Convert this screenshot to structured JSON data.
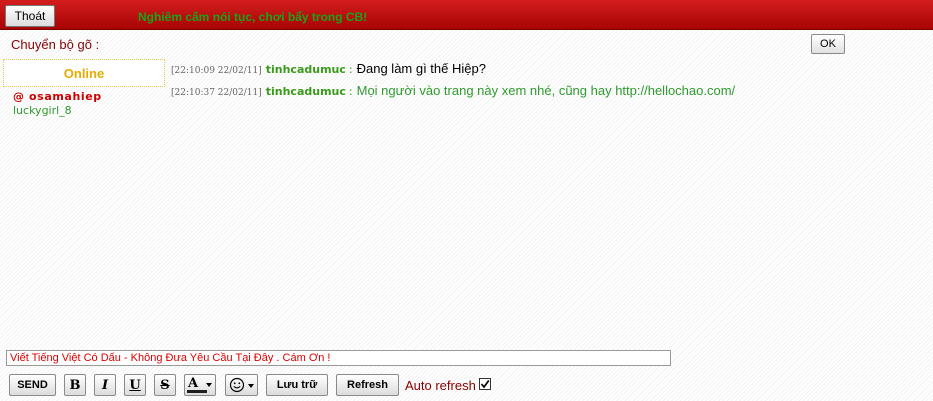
{
  "header": {
    "exit_label": "Thoát",
    "notice": "Nghiêm cấm nói tục, chơi bẩy trong CB!"
  },
  "keyboard": {
    "label": "Chuyển bộ gõ :",
    "ok_label": "OK"
  },
  "sidebar": {
    "online_title": "Online",
    "users": [
      {
        "name": "@ osamahiep",
        "role": "admin"
      },
      {
        "name": "luckygirl_8",
        "role": "member"
      }
    ]
  },
  "messages": [
    {
      "time": "[22:10:09 22/02/11]",
      "nick": "tinhcadumuc",
      "sep": ":",
      "text": "Đang làm gì thế Hiệp?",
      "text_color": "#000000"
    },
    {
      "time": "[22:10:37 22/02/11]",
      "nick": "tinhcadumuc",
      "sep": ":",
      "text": "Mọi người vào trang này xem nhé, cũng hay http://hellochao.com/",
      "text_color": "#2f9a2f"
    }
  ],
  "compose": {
    "value": "Viết Tiếng Việt Có Dấu - Không Đưa Yêu Cầu Tại Đây . Cám Ơn !"
  },
  "toolbar": {
    "send_label": "SEND",
    "bold_label": "B",
    "italic_label": "I",
    "underline_label": "U",
    "strike_label": "S",
    "color_label": "A",
    "save_label": "Lưu trữ",
    "refresh_label": "Refresh",
    "auto_refresh_label": "Auto refresh",
    "auto_refresh_checked": true
  },
  "colors": {
    "header_red": "#c00000",
    "accent_green": "#2f9a2f",
    "label_red": "#8b0000",
    "online_gold": "#e6ab00"
  }
}
